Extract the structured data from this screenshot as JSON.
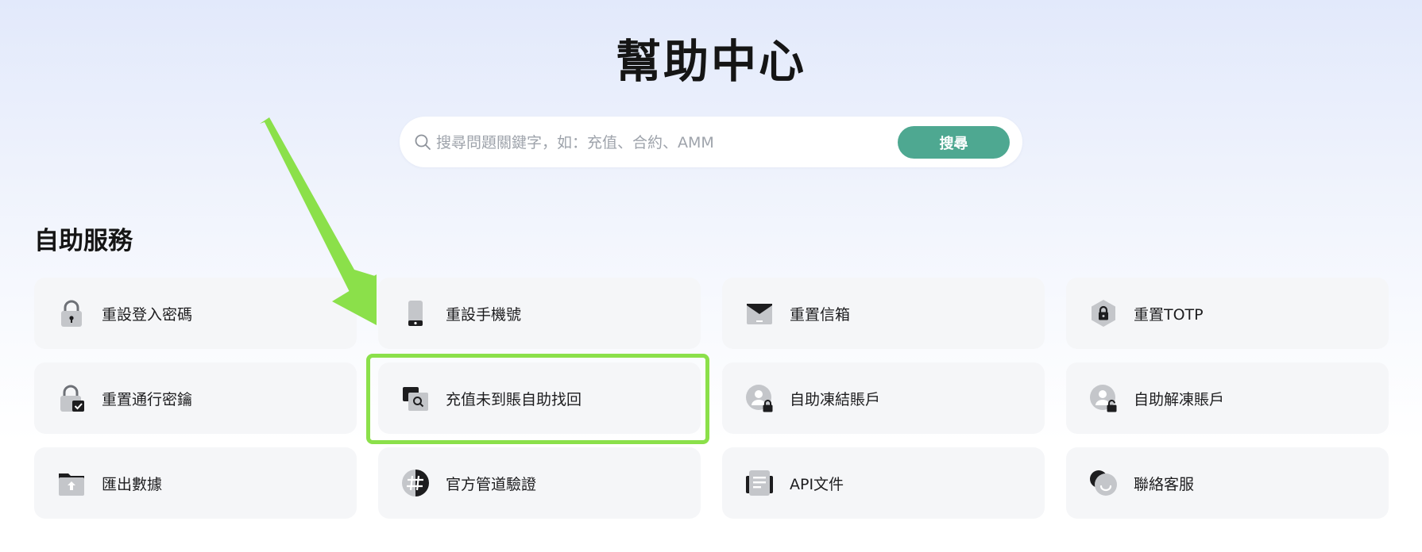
{
  "page": {
    "title": "幫助中心"
  },
  "search": {
    "placeholder": "搜尋問題關鍵字，如：充值、合約、AMM",
    "button_label": "搜尋",
    "accent_color": "#4ea891"
  },
  "self_service": {
    "title": "自助服務",
    "items": [
      {
        "label": "重設登入密碼",
        "icon": "lock-keyhole-icon"
      },
      {
        "label": "重設手機號",
        "icon": "phone-icon"
      },
      {
        "label": "重置信箱",
        "icon": "envelope-icon"
      },
      {
        "label": "重置TOTP",
        "icon": "hexagon-lock-icon"
      },
      {
        "label": "重置通行密鑰",
        "icon": "lock-check-icon"
      },
      {
        "label": "充值未到賬自助找回",
        "icon": "deposit-search-icon"
      },
      {
        "label": "自助凍結賬戶",
        "icon": "user-lock-icon"
      },
      {
        "label": "自助解凍賬戶",
        "icon": "user-unlock-icon"
      },
      {
        "label": "匯出數據",
        "icon": "folder-upload-icon"
      },
      {
        "label": "官方管道驗證",
        "icon": "hash-verify-icon"
      },
      {
        "label": "API文件",
        "icon": "document-icon"
      },
      {
        "label": "聯絡客服",
        "icon": "chat-bubble-icon"
      }
    ]
  },
  "annotation": {
    "arrow_color": "#8be04a",
    "highlight_color": "#8be04a"
  }
}
